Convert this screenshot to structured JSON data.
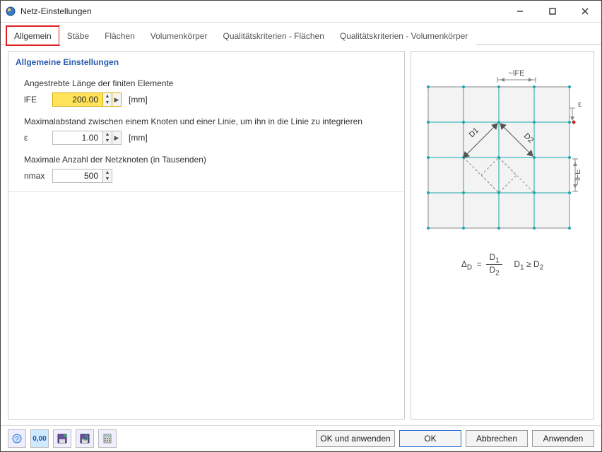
{
  "window": {
    "title": "Netz-Einstellungen"
  },
  "tabs": [
    "Allgemein",
    "Stäbe",
    "Flächen",
    "Volumenkörper",
    "Qualitätskriterien - Flächen",
    "Qualitätskriterien - Volumenkörper"
  ],
  "section_heading": "Allgemeine Einstellungen",
  "lfe": {
    "caption": "Angestrebte Länge der finiten Elemente",
    "label": "lFE",
    "value": "200.00",
    "unit": "[mm]"
  },
  "eps": {
    "caption": "Maximalabstand zwischen einem Knoten und einer Linie, um ihn in die Linie zu integrieren",
    "label": "ε",
    "value": "1.00",
    "unit": "[mm]"
  },
  "nmax": {
    "caption": "Maximale Anzahl der Netzknoten (in Tausenden)",
    "label": "nmax",
    "value": "500"
  },
  "diagram": {
    "top_label": "~lFE",
    "right_label": "~lFE",
    "eps_label": "ε",
    "d1": "D1",
    "d2": "D2"
  },
  "formula": {
    "lhs": "Δ",
    "sub": "D",
    "eq": "=",
    "num": "D",
    "numsub": "1",
    "den": "D",
    "densub": "2",
    "cond": "D",
    "cond1": "1",
    "ge": "≥",
    "cond2": "2"
  },
  "buttons": {
    "ok_apply": "OK und anwenden",
    "ok": "OK",
    "cancel": "Abbrechen",
    "apply": "Anwenden"
  }
}
